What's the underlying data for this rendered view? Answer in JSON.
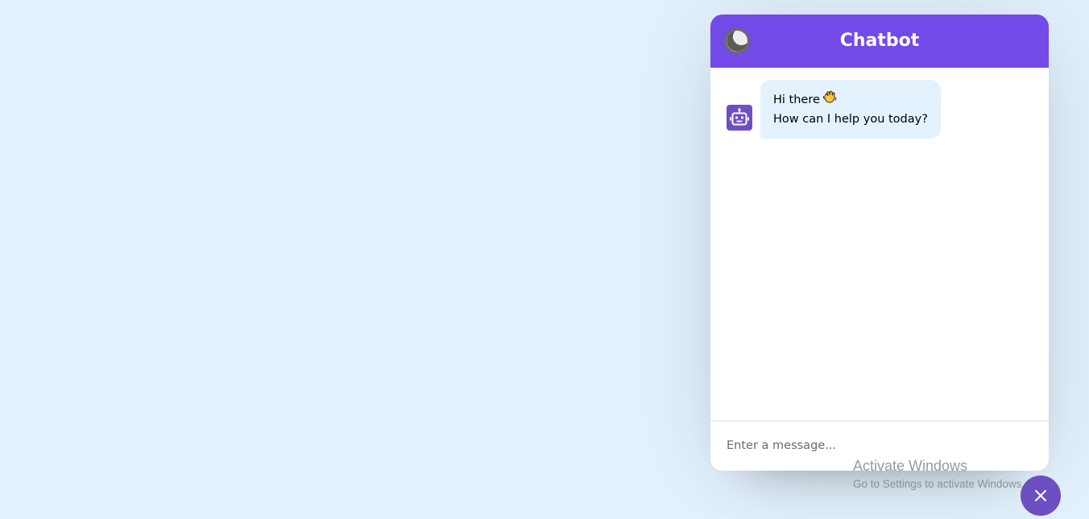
{
  "header": {
    "title": "Chatbot",
    "theme_icon": "moon-icon"
  },
  "messages": [
    {
      "sender": "bot",
      "avatar_icon": "robot-icon",
      "lines": [
        "Hi there",
        "How can I help you today?"
      ],
      "emoji_icon": "waving-hand-icon"
    }
  ],
  "composer": {
    "placeholder": "Enter a message..."
  },
  "toggler": {
    "icon": "close-icon"
  },
  "watermark": {
    "title": "Activate Windows",
    "subtitle": "Go to Settings to activate Windows."
  },
  "colors": {
    "page_background": "#E3F2FD",
    "accent": "#724AE8",
    "bubble_background": "#E3F2FD",
    "avatar_background": "#6D4FC2"
  }
}
